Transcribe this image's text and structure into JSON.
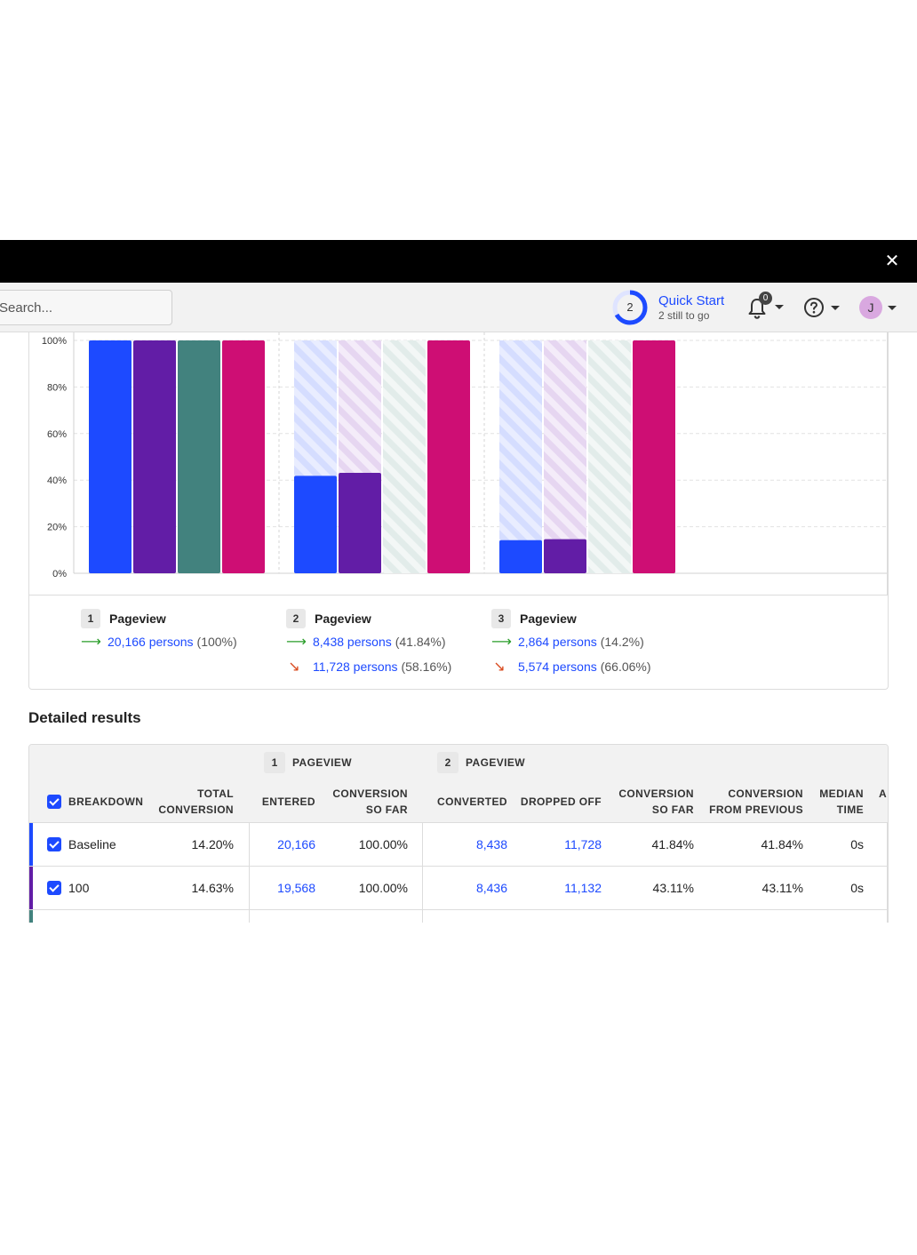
{
  "topbar": {
    "search_placeholder": "Search...",
    "quick_start": {
      "count": "2",
      "title": "Quick Start",
      "subtitle": "2 still to go",
      "progress": 0.67
    },
    "notifications_count": "0",
    "avatar_initial": "J"
  },
  "colors": {
    "blue": "#1d4aff",
    "purple": "#621da6",
    "teal": "#42827e",
    "magenta": "#ce0e74"
  },
  "chart_data": {
    "type": "bar",
    "categories": [
      "1",
      "2",
      "3"
    ],
    "ylim": [
      0,
      100
    ],
    "y_ticks": [
      "0%",
      "20%",
      "40%",
      "60%",
      "80%",
      "100%"
    ],
    "grid": true,
    "series": [
      {
        "values": [
          100,
          41.84,
          14.2
        ],
        "color": "#1d4aff"
      },
      {
        "values": [
          100,
          43.11,
          14.63
        ],
        "color": "#621da6"
      },
      {
        "values": [
          100,
          0,
          0
        ],
        "color": "#42827e"
      },
      {
        "values": [
          100,
          100,
          100
        ],
        "color": "#ce0e74"
      }
    ]
  },
  "steps": [
    {
      "num": "1",
      "name": "Pageview",
      "converted": "20,166 persons",
      "converted_pct": "(100%)",
      "dropped": "",
      "dropped_pct": ""
    },
    {
      "num": "2",
      "name": "Pageview",
      "converted": "8,438 persons",
      "converted_pct": "(41.84%)",
      "dropped": "11,728 persons",
      "dropped_pct": "(58.16%)"
    },
    {
      "num": "3",
      "name": "Pageview",
      "converted": "2,864 persons",
      "converted_pct": "(14.2%)",
      "dropped": "5,574 persons",
      "dropped_pct": "(66.06%)"
    }
  ],
  "detailed": {
    "title": "Detailed results",
    "groups": [
      {
        "num": "1",
        "name": "PAGEVIEW"
      },
      {
        "num": "2",
        "name": "PAGEVIEW"
      }
    ],
    "headers": {
      "breakdown": "BREAKDOWN",
      "total_conversion_1": "TOTAL",
      "total_conversion_2": "CONVERSION",
      "entered": "ENTERED",
      "conv_so_far_1": "CONVERSION",
      "conv_so_far_2": "SO FAR",
      "converted": "CONVERTED",
      "dropped_off": "DROPPED OFF",
      "conv_so_far2_1": "CONVERSION",
      "conv_so_far2_2": "SO FAR",
      "conv_prev_1": "CONVERSION",
      "conv_prev_2": "FROM PREVIOUS",
      "median_1": "MEDIAN",
      "median_2": "TIME",
      "avg_partial": "A"
    },
    "rows": [
      {
        "name": "Baseline",
        "total": "14.20%",
        "entered": "20,166",
        "so_far1": "100.00%",
        "converted": "8,438",
        "dropped": "11,728",
        "so_far2": "41.84%",
        "from_prev": "41.84%",
        "median": "0s",
        "color": "#1d4aff"
      },
      {
        "name": "100",
        "total": "14.63%",
        "entered": "19,568",
        "so_far1": "100.00%",
        "converted": "8,436",
        "dropped": "11,132",
        "so_far2": "43.11%",
        "from_prev": "43.11%",
        "median": "0s",
        "color": "#621da6"
      },
      {
        "name": "",
        "total": "",
        "entered": "",
        "so_far1": "",
        "converted": "",
        "dropped": "",
        "so_far2": "",
        "from_prev": "",
        "median": "",
        "color": "#42827e"
      }
    ]
  }
}
